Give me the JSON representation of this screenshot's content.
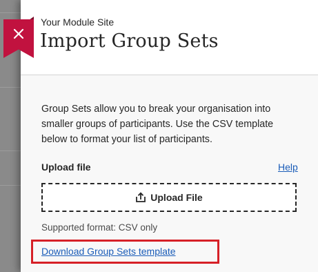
{
  "panel": {
    "site_name": "Your Module Site",
    "title": "Import Group Sets",
    "close_icon": "close-icon",
    "close_color": "#c1123f"
  },
  "body": {
    "description": "Group Sets allow you to break your organisation into smaller groups of participants. Use the CSV template below to format your list of participants.",
    "upload_label": "Upload file",
    "help_link": "Help",
    "upload_button": {
      "label": "Upload File",
      "icon": "upload-icon"
    },
    "supported_format": "Supported format: CSV only",
    "template_link": "Download Group Sets template"
  },
  "colors": {
    "link": "#1a5cb8",
    "highlight": "#d62027",
    "overlay": "#8a8a8a"
  }
}
